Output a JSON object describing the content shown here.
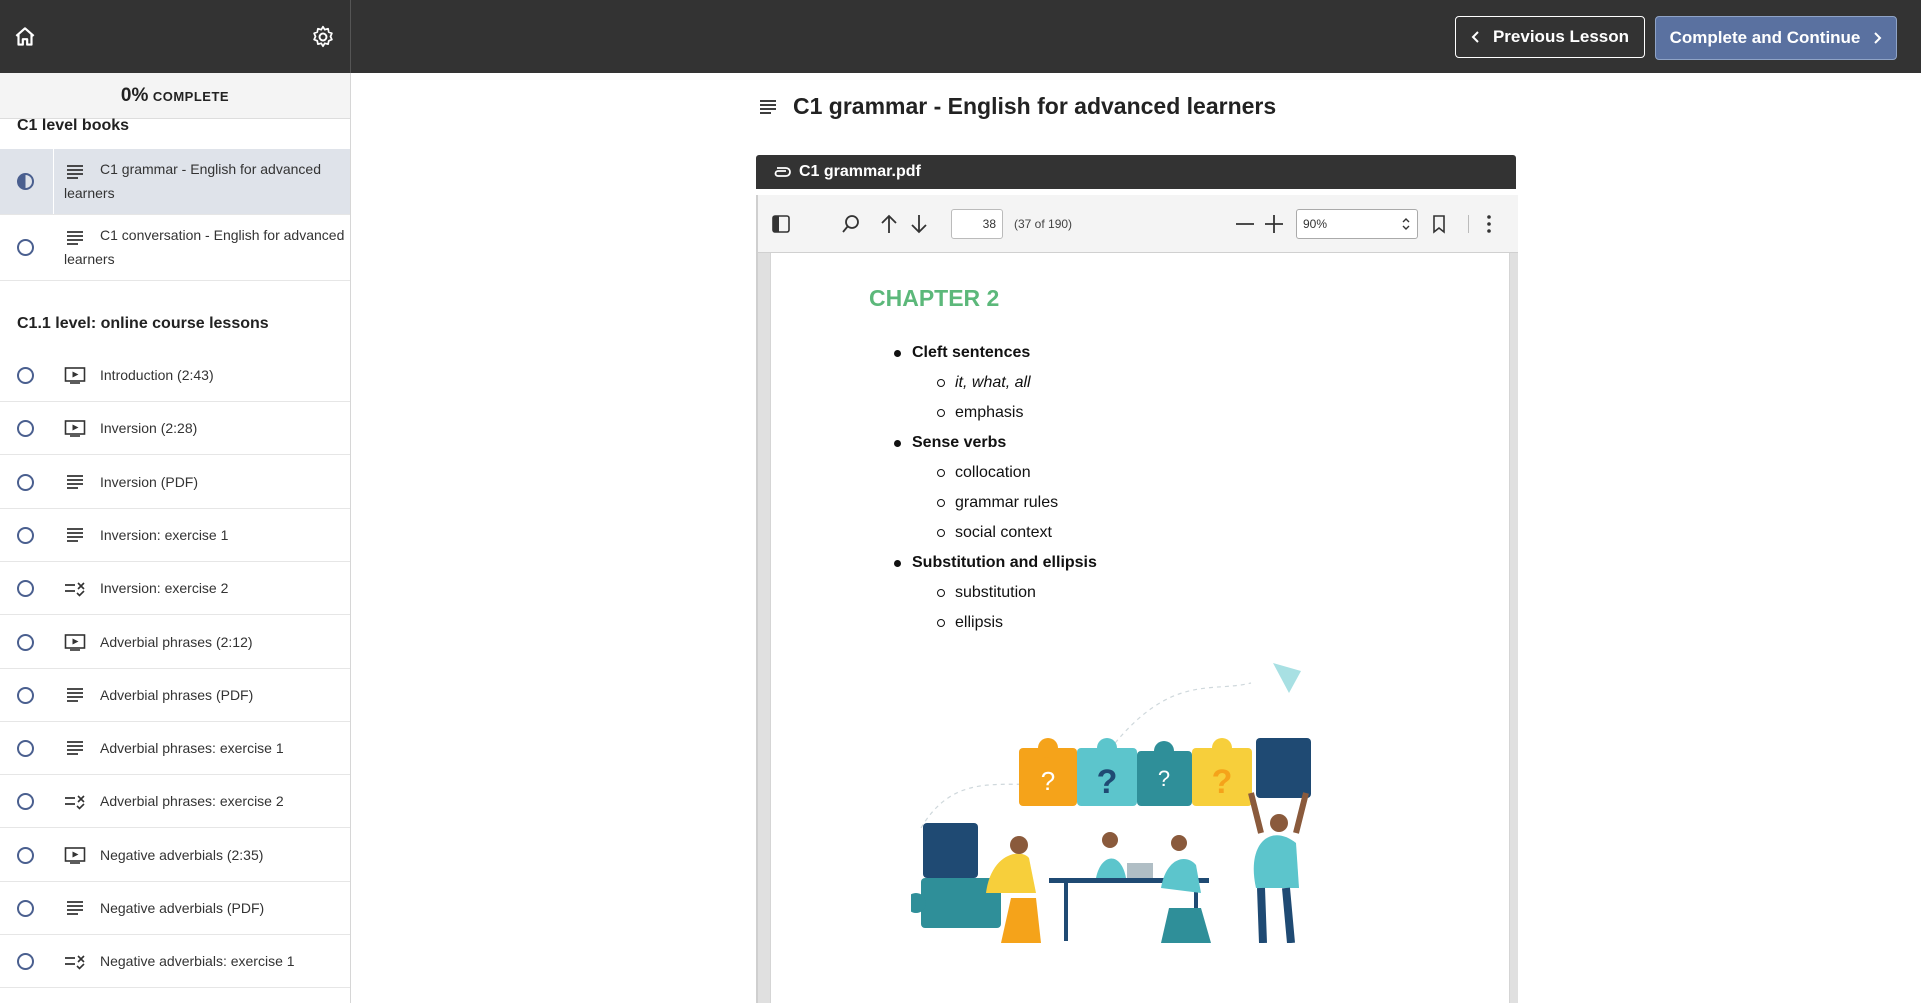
{
  "topbar": {
    "home_icon": "home-icon",
    "settings_icon": "gear-icon",
    "prev_label": "Previous Lesson",
    "next_label": "Complete and Continue"
  },
  "sidebar": {
    "progress_pct": "0%",
    "progress_word": "COMPLETE",
    "sections": [
      {
        "title": "C1 level books",
        "lessons": [
          {
            "label": "C1 grammar - English for advanced learners",
            "type": "text-icon",
            "status": "in-progress",
            "active": true
          },
          {
            "label": "C1 conversation - English for advanced learners",
            "type": "text-icon",
            "status": "not-started",
            "active": false
          }
        ]
      },
      {
        "title": "C1.1 level: online course lessons",
        "lessons": [
          {
            "label": "Introduction (2:43)",
            "type": "video-icon"
          },
          {
            "label": "Inversion (2:28)",
            "type": "video-icon"
          },
          {
            "label": "Inversion (PDF)",
            "type": "text-icon"
          },
          {
            "label": "Inversion: exercise 1",
            "type": "text-icon"
          },
          {
            "label": "Inversion: exercise 2",
            "type": "quiz-icon"
          },
          {
            "label": "Adverbial phrases (2:12)",
            "type": "video-icon"
          },
          {
            "label": "Adverbial phrases (PDF)",
            "type": "text-icon"
          },
          {
            "label": "Adverbial phrases: exercise 1",
            "type": "text-icon"
          },
          {
            "label": "Adverbial phrases: exercise 2",
            "type": "quiz-icon"
          },
          {
            "label": "Negative adverbials (2:35)",
            "type": "video-icon"
          },
          {
            "label": "Negative adverbials (PDF)",
            "type": "text-icon"
          },
          {
            "label": "Negative adverbials: exercise 1",
            "type": "quiz-icon"
          }
        ]
      }
    ]
  },
  "main": {
    "lesson_title": "C1 grammar - English for advanced learners",
    "attachment_name": "C1 grammar.pdf"
  },
  "pdf_viewer": {
    "page_number": "38",
    "page_count_text": "(37 of 190)",
    "zoom": "90%",
    "chapter": "CHAPTER 2",
    "outline": [
      {
        "topic": "Cleft sentences",
        "subs": [
          "it, what, all",
          "emphasis"
        ]
      },
      {
        "topic": "Sense verbs",
        "subs": [
          "collocation",
          "grammar rules",
          "social context"
        ]
      },
      {
        "topic": "Substitution and ellipsis",
        "subs": [
          "substitution",
          "ellipsis"
        ]
      }
    ],
    "puzzle_marks": [
      "?",
      "?",
      "?",
      "?"
    ]
  },
  "colors": {
    "topbar": "#333333",
    "next_button": "#5a71a0",
    "status_ring": "#4a5f8f",
    "active_row": "#dfe3ea",
    "chapter_heading": "#5cb87a",
    "puzzle_orange": "#f5a31a",
    "puzzle_teal": "#5cc5cc",
    "puzzle_dark_teal": "#2f8f99",
    "puzzle_yellow": "#f7cf3b",
    "puzzle_navy": "#1f4a73"
  }
}
